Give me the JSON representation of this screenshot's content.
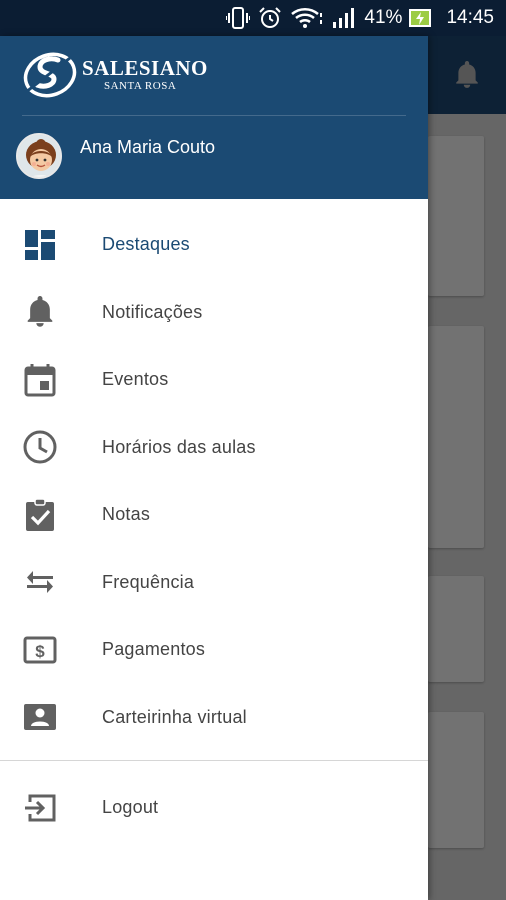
{
  "status_bar": {
    "battery_percent": "41%",
    "time": "14:45",
    "icons": [
      "vibrate-icon",
      "alarm-icon",
      "wifi-icon",
      "signal-icon",
      "battery-charging-icon"
    ]
  },
  "header": {
    "logo_title": "SALESIANO",
    "logo_subtitle": "SANTA ROSA",
    "user_name": "Ana Maria Couto"
  },
  "menu": {
    "items": [
      {
        "label": "Destaques",
        "icon": "dashboard-icon",
        "active": true
      },
      {
        "label": "Notificações",
        "icon": "bell-icon"
      },
      {
        "label": "Eventos",
        "icon": "calendar-icon"
      },
      {
        "label": "Horários das aulas",
        "icon": "clock-icon"
      },
      {
        "label": "Notas",
        "icon": "clipboard-check-icon"
      },
      {
        "label": "Frequência",
        "icon": "swap-arrows-icon"
      },
      {
        "label": "Pagamentos",
        "icon": "money-icon"
      },
      {
        "label": "Carteirinha virtual",
        "icon": "id-card-icon"
      }
    ],
    "logout_label": "Logout"
  },
  "colors": {
    "drawer_header": "#1b4a73",
    "status_bar": "#0b1d33",
    "active_text": "#1b4a73",
    "icon_gray": "#616161"
  }
}
